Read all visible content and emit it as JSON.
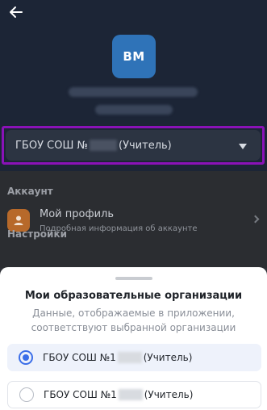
{
  "header": {
    "avatar_initials": "BM",
    "org_selector": {
      "prefix": "ГБОУ СОШ №",
      "suffix": "(Учитель)"
    }
  },
  "content": {
    "account_section": "Аккаунт",
    "profile_title": "Мой профиль",
    "profile_subtitle": "Подробная информация об аккаунте",
    "settings_section": "Настройки"
  },
  "sheet": {
    "title": "Мои образовательные организации",
    "subtitle": "Данные, отображаемые в приложении, соответствуют выбранной организации",
    "options": [
      {
        "prefix": "ГБОУ СОШ №1",
        "suffix": "(Учитель)",
        "selected": true
      },
      {
        "prefix": "ГБОУ СОШ №1",
        "suffix": "(Учитель)",
        "selected": false
      }
    ]
  },
  "colors": {
    "header_bg": "#1c2536",
    "avatar_bg": "#2f73b8",
    "highlight_outline": "#8a12b8",
    "radio_accent": "#3b6ee8",
    "profile_icon_bg": "#b7692a"
  }
}
